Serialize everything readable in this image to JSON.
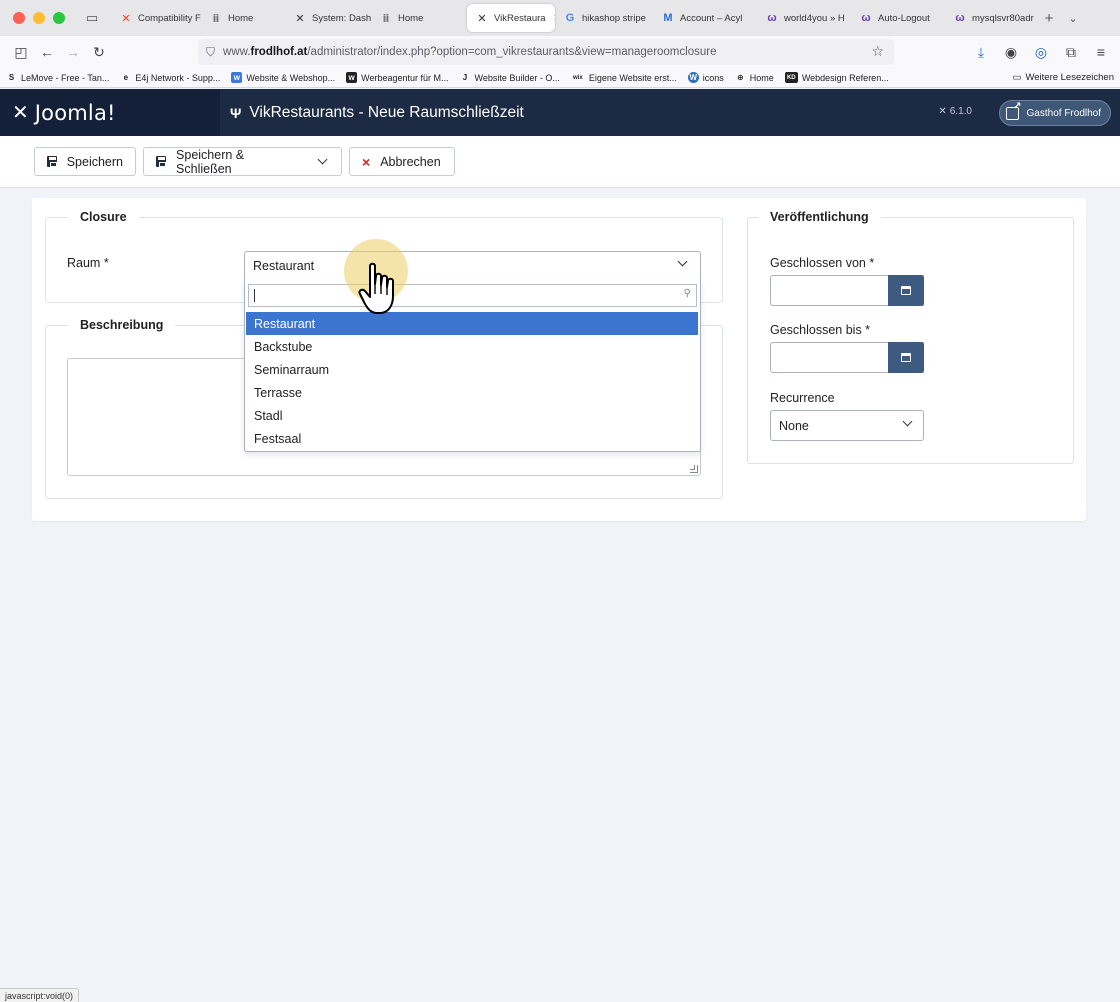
{
  "browser": {
    "tabs": [
      {
        "label": "Compatibility F",
        "icon": "joomla-icon",
        "active": false
      },
      {
        "label": "Home",
        "icon": "site-icon",
        "active": false
      },
      {
        "label": "System: Dashb",
        "icon": "joomla-icon",
        "active": false
      },
      {
        "label": "Home",
        "icon": "site-icon",
        "active": false
      },
      {
        "label": "VikRestaura",
        "icon": "joomla-icon",
        "active": true
      },
      {
        "label": "hikashop stripe",
        "icon": "google-icon",
        "active": false
      },
      {
        "label": "Account – Acyl",
        "icon": "mailchimp-icon",
        "active": false
      },
      {
        "label": "world4you » H",
        "icon": "w4y-icon",
        "active": false
      },
      {
        "label": "Auto-Logout",
        "icon": "w4y-icon",
        "active": false
      },
      {
        "label": "mysqlsvr80adr",
        "icon": "w4y-icon",
        "active": false
      }
    ],
    "url": {
      "prefix": "www.",
      "host": "frodlhof.at",
      "path": "/administrator/index.php?option=com_vikrestaurants&view=manageroomclosure"
    },
    "bookmarks": [
      {
        "label": "LeMove - Free - Tan...",
        "icon": "S"
      },
      {
        "label": "E4j Network - Supp...",
        "icon": "e"
      },
      {
        "label": "Website & Webshop...",
        "icon": "w"
      },
      {
        "label": "Werbeagentur für M...",
        "icon": "w"
      },
      {
        "label": "Website Builder - O...",
        "icon": "J"
      },
      {
        "label": "Eigene Website erst...",
        "icon": "wix"
      },
      {
        "label": "icons",
        "icon": "W"
      },
      {
        "label": "Home",
        "icon": "globe"
      },
      {
        "label": "Webdesign Referen...",
        "icon": "KD"
      }
    ],
    "bookmarks_folder": "Weitere Lesezeichen",
    "status_text": "javascript:void(0)"
  },
  "header": {
    "logo_text": "Joomla!",
    "title": "VikRestaurants - Neue Raumschließzeit",
    "version": "6.1.0",
    "site_button": "Gasthof Frodlhof"
  },
  "toolbar": {
    "save": "Speichern",
    "save_close": "Speichern & Schließen",
    "cancel": "Abbrechen"
  },
  "form": {
    "closure_legend": "Closure",
    "room_label": "Raum *",
    "room_value": "Restaurant",
    "room_options": [
      "Restaurant",
      "Backstube",
      "Seminarraum",
      "Terrasse",
      "Stadl",
      "Festsaal"
    ],
    "room_selected_index": 0,
    "description_legend": "Beschreibung",
    "publish_legend": "Veröffentlichung",
    "closed_from_label": "Geschlossen von *",
    "closed_to_label": "Geschlossen bis *",
    "recurrence_label": "Recurrence",
    "recurrence_value": "None"
  },
  "colors": {
    "header_bg": "#1c2a44",
    "accent": "#3d5a80",
    "selected_option": "#3b75d0",
    "cancel_icon": "#c52827"
  }
}
